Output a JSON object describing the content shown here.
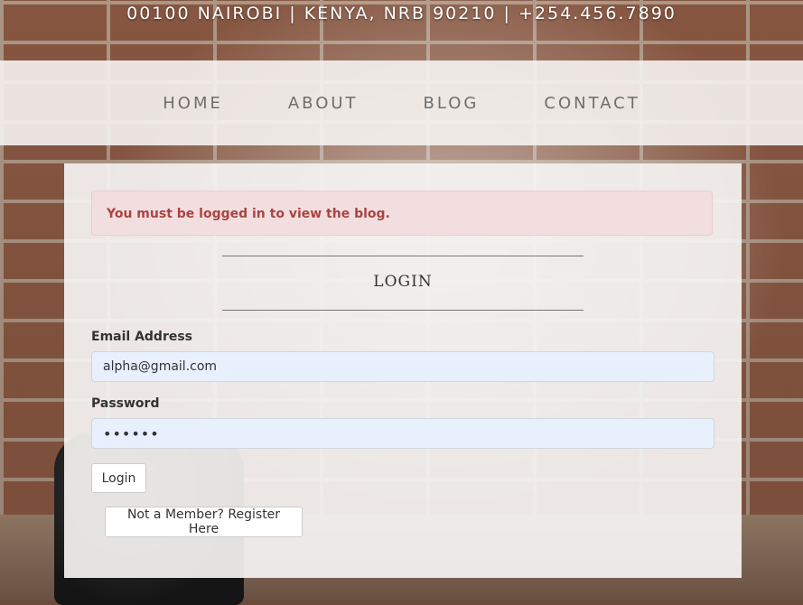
{
  "topbar": {
    "address": "00100 NAIROBI | KENYA, NRB 90210 | +254.456.7890"
  },
  "nav": {
    "items": [
      "HOME",
      "ABOUT",
      "BLOG",
      "CONTACT"
    ]
  },
  "alert": {
    "message": "You must be logged in to view the blog."
  },
  "login": {
    "title": "LOGIN",
    "email_label": "Email Address",
    "email_value": "alpha@gmail.com",
    "password_label": "Password",
    "password_value": "••••••",
    "submit_label": "Login",
    "register_label": "Not a Member? Register Here"
  }
}
